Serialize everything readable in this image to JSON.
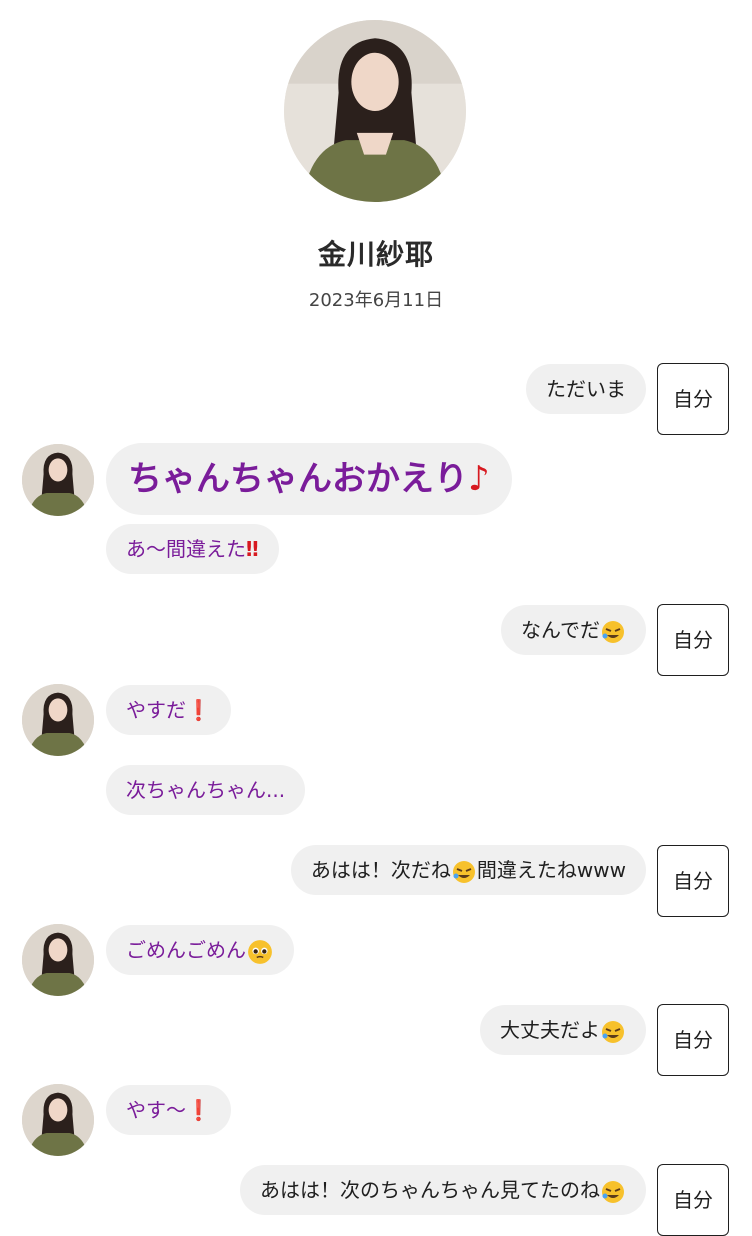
{
  "profile": {
    "name": "金川紗耶",
    "date": "2023年6月11日"
  },
  "me_label": "自分",
  "messages": [
    {
      "from": "me",
      "text": "ただいま"
    },
    {
      "from": "them",
      "text": "ちゃんちゃんおかえり",
      "suffix": "♪"
    },
    {
      "from": "them",
      "text": "あ〜間違えた",
      "suffix": "‼"
    },
    {
      "from": "me",
      "text": "なんでだ"
    },
    {
      "from": "them",
      "text": "やすだ",
      "suffix": "❗"
    },
    {
      "from": "them",
      "text": "次ちゃんちゃん..."
    },
    {
      "from": "me",
      "text_a": "あはは！次だね",
      "text_b": "間違えたねwww"
    },
    {
      "from": "them",
      "text": "ごめんごめん"
    },
    {
      "from": "me",
      "text": "大丈夫だよ"
    },
    {
      "from": "them",
      "text": "やす〜",
      "suffix": "❗"
    },
    {
      "from": "me",
      "text": "あはは！次のちゃんちゃん見てたのね"
    }
  ],
  "icons": {
    "laugh": "rolling-on-floor-laughing-emoji",
    "pleading": "pleading-face-emoji",
    "avatar": "member-avatar"
  },
  "colors": {
    "member_text": "#7a1c9a",
    "accent_red": "#d71920",
    "bubble_bg": "#f0f0f0"
  }
}
